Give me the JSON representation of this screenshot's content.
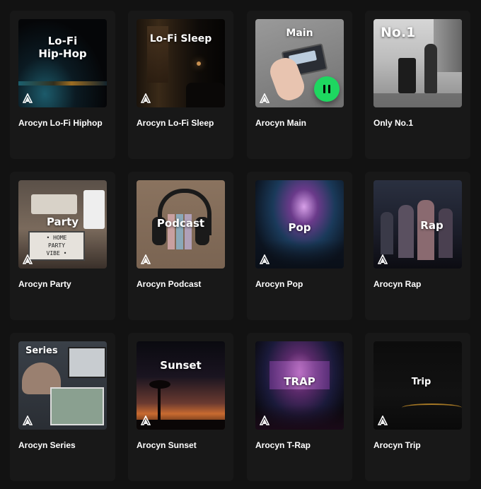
{
  "colors": {
    "background": "#121212",
    "card": "#181818",
    "accent": "#1ed760"
  },
  "playlists": [
    {
      "cover_title": "Lo-Fi\nHip-Hop",
      "name": "Arocyn Lo-Fi Hiphop"
    },
    {
      "cover_title": "Lo-Fi Sleep",
      "name": "Arocyn Lo-Fi Sleep"
    },
    {
      "cover_title": "Main",
      "name": "Arocyn Main",
      "playing": true,
      "play_icon": "pause-icon"
    },
    {
      "cover_title": "No.1",
      "name": "Only No.1"
    },
    {
      "cover_title": "Party",
      "name": "Arocyn Party",
      "cover_sign": "• HOME\nPARTY\nVIBE •"
    },
    {
      "cover_title": "Podcast",
      "name": "Arocyn Podcast"
    },
    {
      "cover_title": "Pop",
      "name": "Arocyn Pop"
    },
    {
      "cover_title": "Rap",
      "name": "Arocyn Rap"
    },
    {
      "cover_title": "Series",
      "name": "Arocyn Series"
    },
    {
      "cover_title": "Sunset",
      "name": "Arocyn Sunset"
    },
    {
      "cover_title": "TRAP",
      "name": "Arocyn T-Rap"
    },
    {
      "cover_title": "Trip",
      "name": "Arocyn Trip"
    }
  ]
}
